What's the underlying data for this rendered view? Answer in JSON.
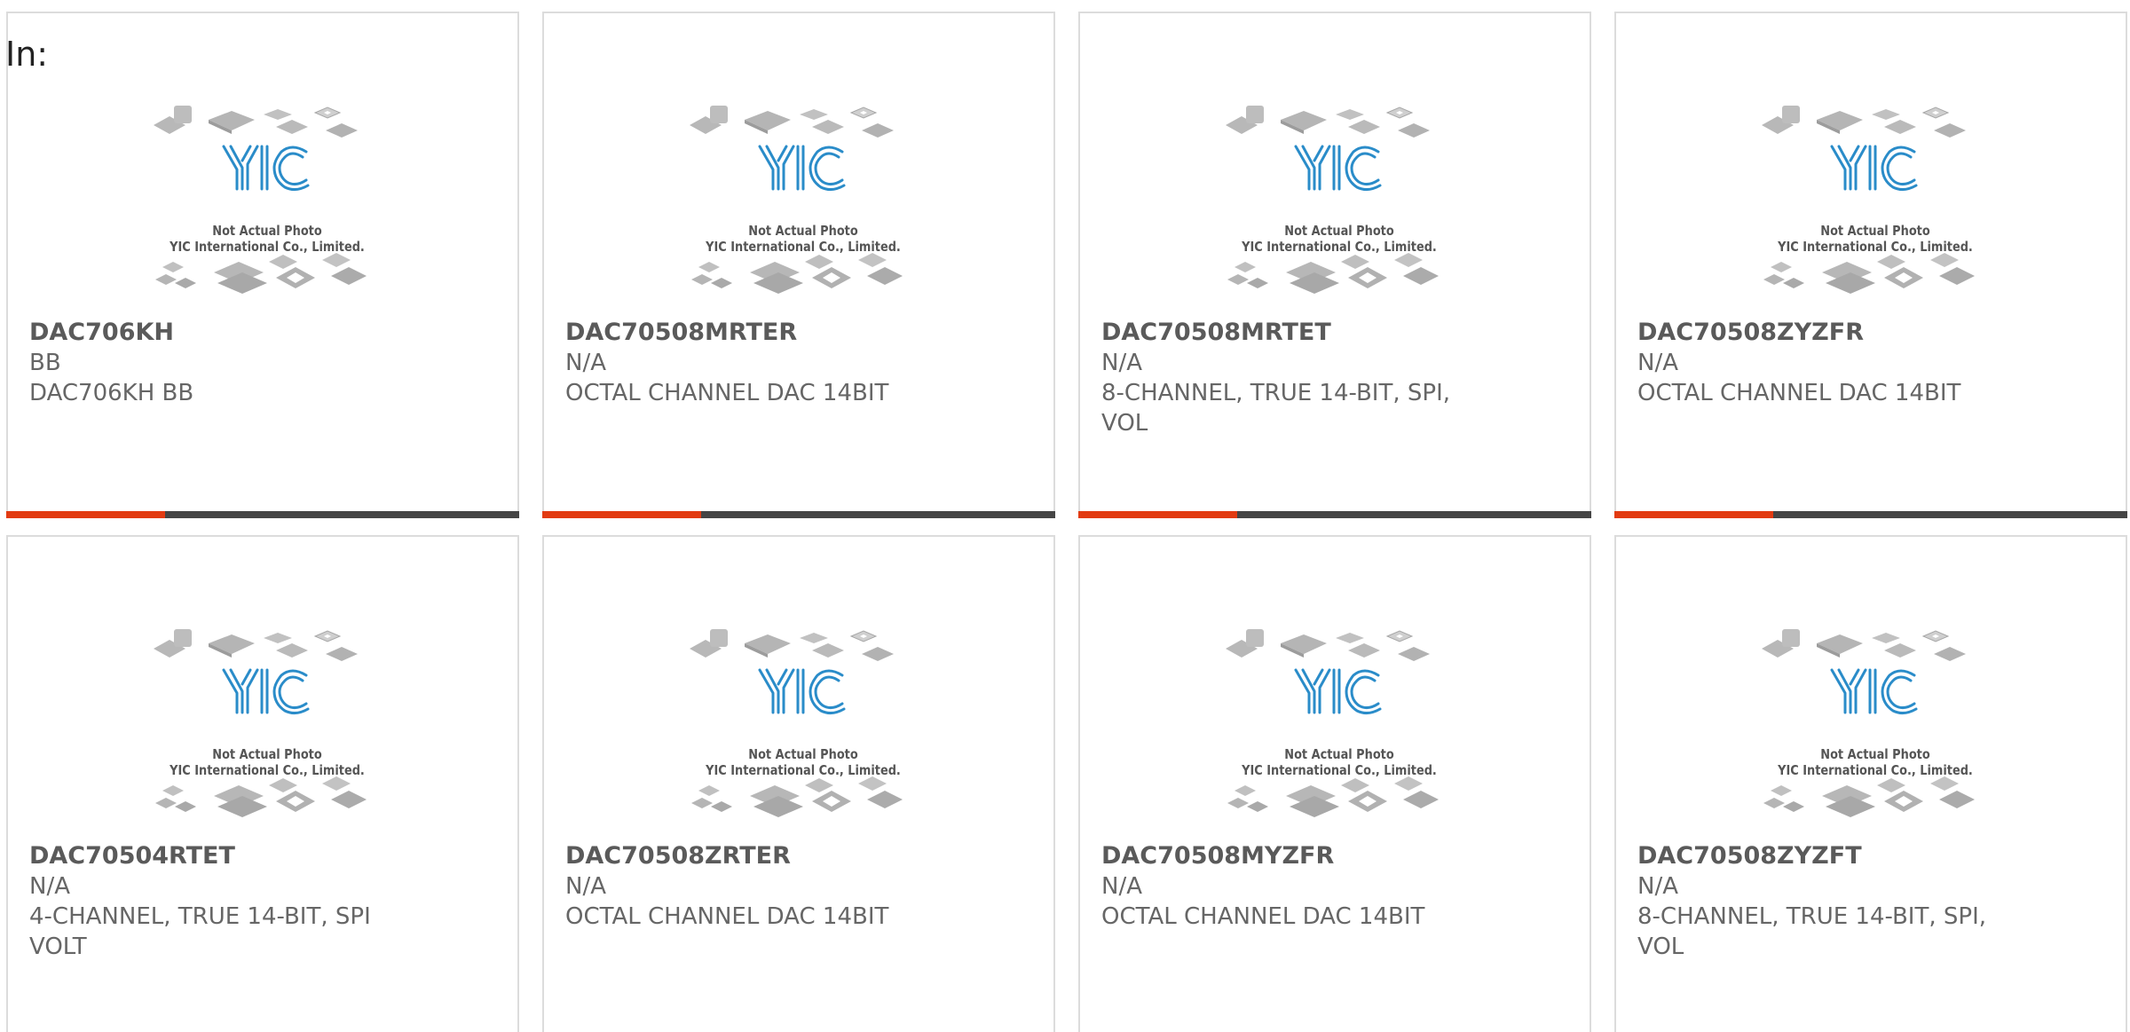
{
  "header": {
    "label": "In:"
  },
  "theme": {
    "accent": "#e23b12",
    "bar": "#454545",
    "border": "#dcdcdc"
  },
  "placeholder": {
    "line1": "Not Actual Photo",
    "line2": "YIC International Co., Limited."
  },
  "products": [
    {
      "part": "DAC706KH",
      "brand": "BB",
      "desc": "DAC706KH BB",
      "accent_fraction": 0.31
    },
    {
      "part": "DAC70508MRTER",
      "brand": "N/A",
      "desc": "OCTAL CHANNEL DAC 14BIT",
      "accent_fraction": 0.31
    },
    {
      "part": "DAC70508MRTET",
      "brand": "N/A",
      "desc": "8-CHANNEL, TRUE 14-BIT, SPI, VOL",
      "accent_fraction": 0.31
    },
    {
      "part": "DAC70508ZYZFR",
      "brand": "N/A",
      "desc": "OCTAL CHANNEL DAC 14BIT",
      "accent_fraction": 0.31
    },
    {
      "part": "DAC70504RTET",
      "brand": "N/A",
      "desc": "4-CHANNEL, TRUE 14-BIT, SPI VOLT"
    },
    {
      "part": "DAC70508ZRTER",
      "brand": "N/A",
      "desc": "OCTAL CHANNEL DAC 14BIT"
    },
    {
      "part": "DAC70508MYZFR",
      "brand": "N/A",
      "desc": "OCTAL CHANNEL DAC 14BIT"
    },
    {
      "part": "DAC70508ZYZFT",
      "brand": "N/A",
      "desc": "8-CHANNEL, TRUE 14-BIT, SPI, VOL"
    }
  ]
}
